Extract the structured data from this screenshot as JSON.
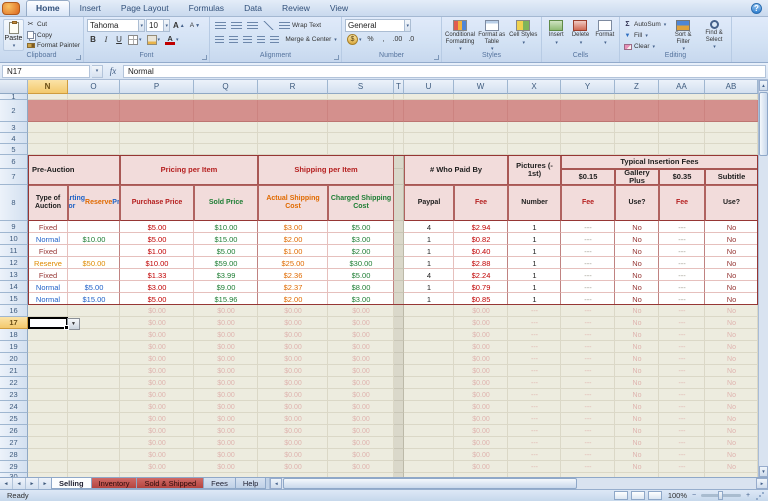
{
  "icons": {
    "down": "▼",
    "dd": "▾",
    "up": "▲",
    "left": "◄",
    "right": "►",
    "scissors": "✂",
    "sigma": "Σ",
    "minus": "−",
    "plus": "+",
    "question": "?"
  },
  "ribbon": {
    "tabs": [
      "Home",
      "Insert",
      "Page Layout",
      "Formulas",
      "Data",
      "Review",
      "View"
    ],
    "active_tab": "Home",
    "clipboard": {
      "label": "Clipboard",
      "paste": "Paste",
      "cut": "Cut",
      "copy": "Copy",
      "painter": "Format Painter"
    },
    "font": {
      "label": "Font",
      "name": "Tahoma",
      "size": "10",
      "bold": "B",
      "italic": "I",
      "underline": "U"
    },
    "alignment": {
      "label": "Alignment",
      "wrap": "Wrap Text",
      "merge": "Merge & Center"
    },
    "number": {
      "label": "Number",
      "format": "General",
      "currency": "$",
      "percent": "%",
      "comma": ",",
      "inc_decimal": ".00",
      "dec_decimal": ".0"
    },
    "styles": {
      "label": "Styles",
      "conditional": "Conditional Formatting",
      "astable": "Format as Table",
      "cellstyles": "Cell Styles"
    },
    "cells": {
      "label": "Cells",
      "insert": "Insert",
      "delete": "Delete",
      "format": "Format"
    },
    "editing": {
      "label": "Editing",
      "autosum": "AutoSum",
      "fill": "Fill",
      "clear": "Clear",
      "sort": "Sort & Filter",
      "find": "Find & Select"
    }
  },
  "formula_bar": {
    "name_box": "N17",
    "fx": "fx",
    "value": "Normal"
  },
  "sheet": {
    "columns": [
      "N",
      "O",
      "P",
      "Q",
      "R",
      "S",
      "T",
      "U",
      "W",
      "X",
      "Y",
      "Z",
      "AA",
      "AB"
    ],
    "selected_cell": {
      "column": "N",
      "row": 17
    },
    "table": {
      "groups": {
        "pre_auction": "Pre-Auction",
        "pricing": "Pricing per Item",
        "shipping": "Shipping per Item",
        "paid_by": "# Who Paid By",
        "insertion_fees": "Typical Insertion Fees",
        "pictures": "Pictures (- 1st)",
        "fee_015": "$0.15",
        "gallery_plus": "Gallery Plus",
        "fee_035": "$0.35",
        "subtitle": "Subtitle"
      },
      "headers": {
        "type": "Type of Auction",
        "start": "Starting or Reserve Price",
        "purchase": "Purchase Price",
        "sold": "Sold Price",
        "actual_ship": "Actual Shipping Cost",
        "charged_ship": "Charged Shipping Cost",
        "paypal": "Paypal",
        "fee": "Fee",
        "number": "Number",
        "use": "Use?"
      },
      "rows": [
        {
          "row": 9,
          "type": "Fixed",
          "start": "",
          "start_color": "",
          "purchase": "$5.00",
          "sold": "$10.00",
          "actual": "$3.00",
          "charged": "$5.00",
          "paypal": "4",
          "paypal_fee": "$2.94",
          "pictures": "1",
          "picture_fee": "---",
          "gallery": "No",
          "gallery_fee": "---",
          "subtitle": "No"
        },
        {
          "row": 10,
          "type": "Normal",
          "start": "$10.00",
          "start_color": "green",
          "purchase": "$5.00",
          "sold": "$15.00",
          "actual": "$2.00",
          "charged": "$3.00",
          "paypal": "1",
          "paypal_fee": "$0.82",
          "pictures": "1",
          "picture_fee": "---",
          "gallery": "No",
          "gallery_fee": "---",
          "subtitle": "No"
        },
        {
          "row": 11,
          "type": "Fixed",
          "start": "",
          "start_color": "",
          "purchase": "$1.00",
          "sold": "$5.00",
          "actual": "$1.00",
          "charged": "$2.00",
          "paypal": "1",
          "paypal_fee": "$0.40",
          "pictures": "1",
          "picture_fee": "---",
          "gallery": "No",
          "gallery_fee": "---",
          "subtitle": "No"
        },
        {
          "row": 12,
          "type": "Reserve",
          "start": "$50.00",
          "start_color": "orange",
          "purchase": "$10.00",
          "sold": "$59.00",
          "actual": "$25.00",
          "charged": "$30.00",
          "paypal": "1",
          "paypal_fee": "$2.88",
          "pictures": "1",
          "picture_fee": "---",
          "gallery": "No",
          "gallery_fee": "---",
          "subtitle": "No"
        },
        {
          "row": 13,
          "type": "Fixed",
          "start": "",
          "start_color": "",
          "purchase": "$1.33",
          "sold": "$3.99",
          "actual": "$2.36",
          "charged": "$5.00",
          "paypal": "4",
          "paypal_fee": "$2.24",
          "pictures": "1",
          "picture_fee": "---",
          "gallery": "No",
          "gallery_fee": "---",
          "subtitle": "No"
        },
        {
          "row": 14,
          "type": "Normal",
          "start": "$5.00",
          "start_color": "blue",
          "purchase": "$3.00",
          "sold": "$9.00",
          "actual": "$2.37",
          "charged": "$8.00",
          "paypal": "1",
          "paypal_fee": "$0.79",
          "pictures": "1",
          "picture_fee": "---",
          "gallery": "No",
          "gallery_fee": "---",
          "subtitle": "No"
        },
        {
          "row": 15,
          "type": "Normal",
          "start": "$15.00",
          "start_color": "blue",
          "purchase": "$5.00",
          "sold": "$15.96",
          "actual": "$2.00",
          "charged": "$3.00",
          "paypal": "1",
          "paypal_fee": "$0.85",
          "pictures": "1",
          "picture_fee": "---",
          "gallery": "No",
          "gallery_fee": "---",
          "subtitle": "No"
        }
      ],
      "ghost_row": {
        "purchase": "$0.00",
        "sold": "$0.00",
        "actual": "$0.00",
        "charged": "$0.00",
        "paypal": "",
        "paypal_fee": "$0.00",
        "pictures": "---",
        "picture_fee": "---",
        "gallery": "No",
        "gallery_fee": "---",
        "subtitle": "No"
      }
    }
  },
  "sheet_tabs": [
    {
      "label": "Selling",
      "active": true,
      "color": "default"
    },
    {
      "label": "Inventory",
      "active": false,
      "color": "red"
    },
    {
      "label": "Sold & Shipped",
      "active": false,
      "color": "red"
    },
    {
      "label": "Fees",
      "active": false,
      "color": "default"
    },
    {
      "label": "Help",
      "active": false,
      "color": "default"
    }
  ],
  "status_bar": {
    "mode": "Ready",
    "zoom": "100%"
  }
}
